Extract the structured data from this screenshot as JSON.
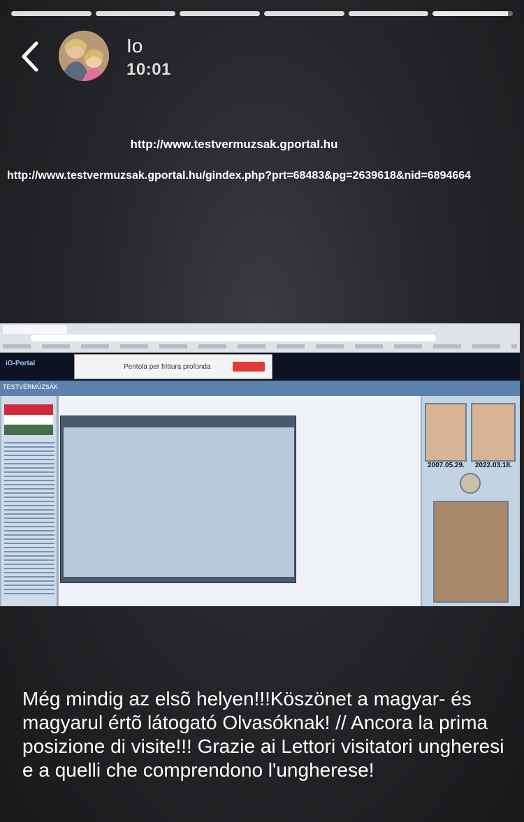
{
  "story": {
    "progress_segments": 6,
    "current_segment": 6,
    "current_progress": 0.94
  },
  "header": {
    "username": "Io",
    "time": "10:01"
  },
  "post": {
    "link_short": "http://www.testvermuzsak.gportal.hu",
    "link_long": "http://www.testvermuzsak.gportal.hu/gindex.php?prt=68483&pg=2639618&nid=6894664",
    "caption": "Még mindig az elsõ helyen!!!Köszönet a magyar- és magyarul értõ látogató Olvasóknak! // Ancora la prima posizione di visite!!! Grazie ai Lettori visitatori ungheresi e a quelli che comprendono l'ungherese!"
  },
  "screenshot": {
    "ad_text": "Pentola per frittura profonda",
    "date_left": "2007.05.29.",
    "date_right": "2022.03.18."
  },
  "colors": {
    "background": "#26272a",
    "text": "#ffffff"
  }
}
